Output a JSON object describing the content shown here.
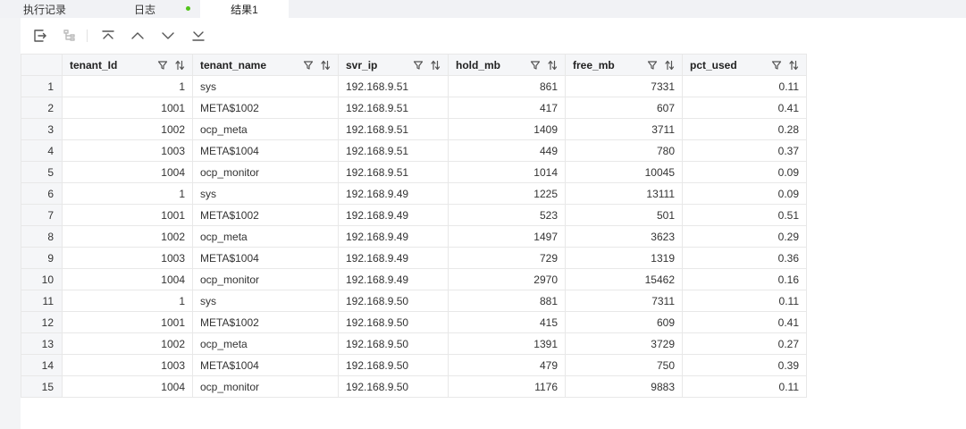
{
  "tabs": [
    {
      "label": "执行记录",
      "active": false
    },
    {
      "label": "日志",
      "active": false,
      "status_dot": "#52c41a"
    },
    {
      "label": "结果1",
      "active": true
    }
  ],
  "toolbar": {
    "buttons": [
      "export-icon",
      "tree-view-icon",
      "first-row-icon",
      "previous-row-icon",
      "next-row-icon",
      "last-row-icon"
    ]
  },
  "table": {
    "columns": [
      {
        "key": "tenant_id",
        "label": "tenant_Id",
        "align": "right"
      },
      {
        "key": "tenant_name",
        "label": "tenant_name",
        "align": "left"
      },
      {
        "key": "svr_ip",
        "label": "svr_ip",
        "align": "left"
      },
      {
        "key": "hold_mb",
        "label": "hold_mb",
        "align": "right"
      },
      {
        "key": "free_mb",
        "label": "free_mb",
        "align": "right"
      },
      {
        "key": "pct_used",
        "label": "pct_used",
        "align": "right"
      }
    ],
    "rows": [
      [
        "1",
        "1",
        "sys",
        "192.168.9.51",
        "861",
        "7331",
        "0.11"
      ],
      [
        "2",
        "1001",
        "META$1002",
        "192.168.9.51",
        "417",
        "607",
        "0.41"
      ],
      [
        "3",
        "1002",
        "ocp_meta",
        "192.168.9.51",
        "1409",
        "3711",
        "0.28"
      ],
      [
        "4",
        "1003",
        "META$1004",
        "192.168.9.51",
        "449",
        "780",
        "0.37"
      ],
      [
        "5",
        "1004",
        "ocp_monitor",
        "192.168.9.51",
        "1014",
        "10045",
        "0.09"
      ],
      [
        "6",
        "1",
        "sys",
        "192.168.9.49",
        "1225",
        "13111",
        "0.09"
      ],
      [
        "7",
        "1001",
        "META$1002",
        "192.168.9.49",
        "523",
        "501",
        "0.51"
      ],
      [
        "8",
        "1002",
        "ocp_meta",
        "192.168.9.49",
        "1497",
        "3623",
        "0.29"
      ],
      [
        "9",
        "1003",
        "META$1004",
        "192.168.9.49",
        "729",
        "1319",
        "0.36"
      ],
      [
        "10",
        "1004",
        "ocp_monitor",
        "192.168.9.49",
        "2970",
        "15462",
        "0.16"
      ],
      [
        "11",
        "1",
        "sys",
        "192.168.9.50",
        "881",
        "7311",
        "0.11"
      ],
      [
        "12",
        "1001",
        "META$1002",
        "192.168.9.50",
        "415",
        "609",
        "0.41"
      ],
      [
        "13",
        "1002",
        "ocp_meta",
        "192.168.9.50",
        "1391",
        "3729",
        "0.27"
      ],
      [
        "14",
        "1003",
        "META$1004",
        "192.168.9.50",
        "479",
        "750",
        "0.39"
      ],
      [
        "15",
        "1004",
        "ocp_monitor",
        "192.168.9.50",
        "1176",
        "9883",
        "0.11"
      ]
    ]
  }
}
